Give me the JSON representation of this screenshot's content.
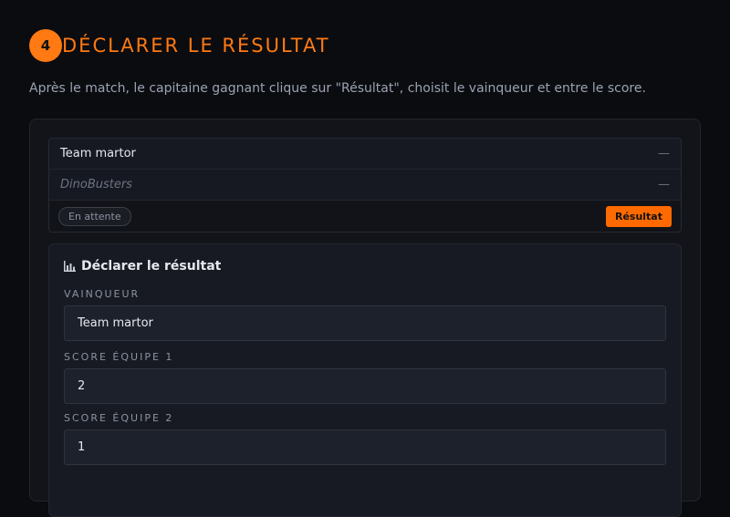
{
  "step": {
    "number": "4",
    "title": "DÉCLARER LE RÉSULTAT",
    "description": "Après le match, le capitaine gagnant clique sur \"Résultat\", choisit le vainqueur et entre le score."
  },
  "match": {
    "team1": {
      "name": "Team martor",
      "score": "—"
    },
    "team2": {
      "name": "DinoBusters",
      "score": "—"
    },
    "status": "En attente",
    "result_button": "Résultat"
  },
  "form": {
    "title": "Déclarer le résultat",
    "title_icon": "bar-chart-icon",
    "winner_label": "VAINQUEUR",
    "winner_value": "Team martor",
    "score1_label": "SCORE ÉQUIPE 1",
    "score1_value": "2",
    "score2_label": "SCORE ÉQUIPE 2",
    "score2_value": "1"
  },
  "colors": {
    "accent": "#ff7a12",
    "background": "#0b0c10"
  }
}
